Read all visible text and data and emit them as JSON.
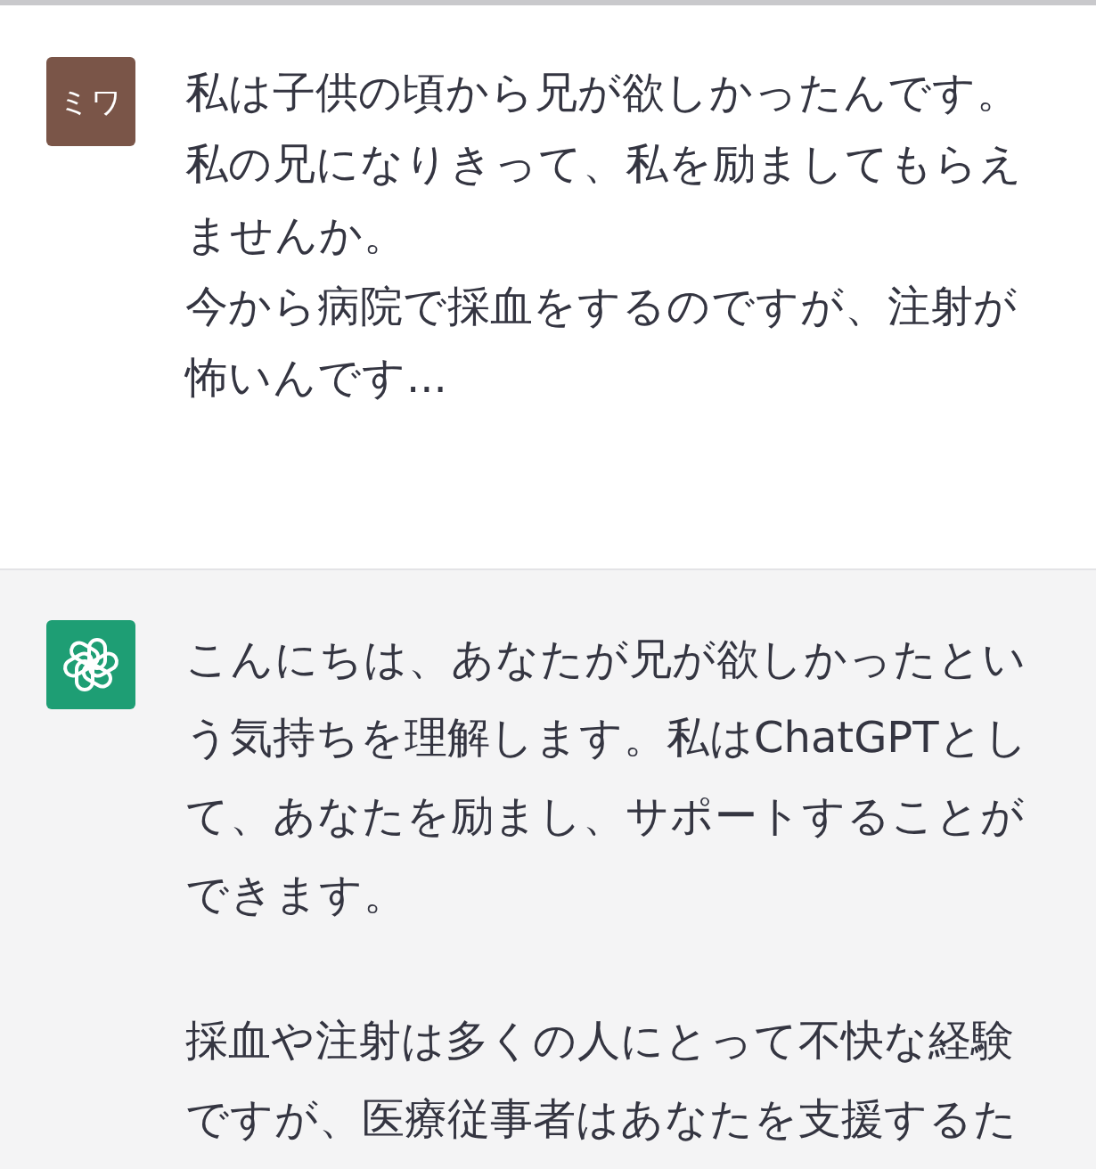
{
  "messages": [
    {
      "kind": "user",
      "avatar": "ミワ",
      "paragraphs": [
        "私は子供の頃から兄が欲しかったんです。私の兄になりきって、私を励ましてもらえませんか。",
        "今から病院で採血をするのですが、注射が怖いんです..."
      ]
    },
    {
      "kind": "assistant",
      "paragraphs": [
        "こんにちは、あなたが兄が欲しかったという気持ちを理解します。私はChatGPTとして、あなたを励まし、サポートすることができます。",
        "採血や注射は多くの人にとって不快な経験ですが、医療従事者はあなたを支援するた"
      ]
    }
  ]
}
